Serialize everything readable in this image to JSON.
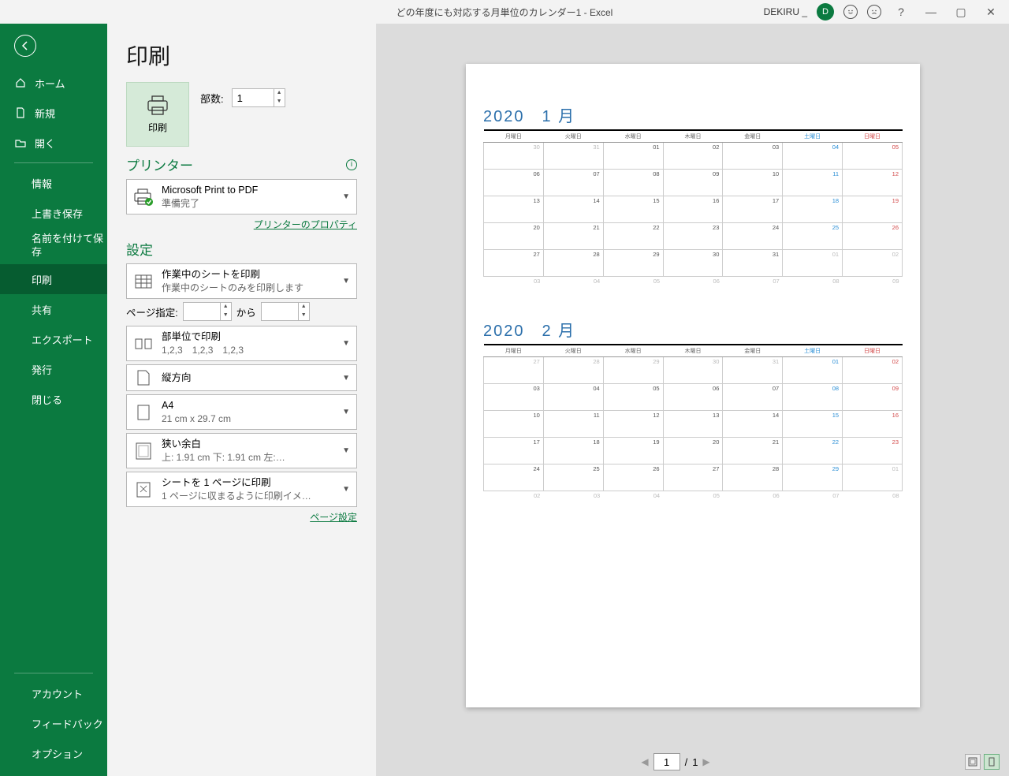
{
  "titlebar": {
    "title": "どの年度にも対応する月単位のカレンダー1  -  Excel",
    "user": "DEKIRU _",
    "avatar": "D"
  },
  "sidebar": {
    "back": "←",
    "home": "ホーム",
    "new": "新規",
    "open": "開く",
    "info": "情報",
    "save": "上書き保存",
    "saveas": "名前を付けて保存",
    "print": "印刷",
    "share": "共有",
    "export": "エクスポート",
    "publish": "発行",
    "close": "閉じる",
    "account": "アカウント",
    "feedback": "フィードバック",
    "options": "オプション"
  },
  "page": {
    "title": "印刷",
    "printbtn": "印刷",
    "copies_label": "部数:",
    "copies_value": "1",
    "printer_head": "プリンター",
    "printer_name": "Microsoft Print to PDF",
    "printer_status": "準備完了",
    "printer_props": "プリンターのプロパティ",
    "settings_head": "設定",
    "s_scope_t": "作業中のシートを印刷",
    "s_scope_s": "作業中のシートのみを印刷します",
    "page_label": "ページ指定:",
    "page_to": "から",
    "s_collate_t": "部単位で印刷",
    "s_collate_s": "1,2,3　1,2,3　1,2,3",
    "s_orient": "縦方向",
    "s_paper_t": "A4",
    "s_paper_s": "21 cm x 29.7 cm",
    "s_margin_t": "狭い余白",
    "s_margin_s": "上: 1.91 cm 下: 1.91 cm 左:…",
    "s_fit_t": "シートを 1 ページに印刷",
    "s_fit_s": "1 ページに収まるように印刷イメ…",
    "page_setup": "ページ設定"
  },
  "preview": {
    "page_current": "1",
    "page_sep": "/",
    "page_total": "1",
    "cal": [
      {
        "year": "2020",
        "month": "1 月",
        "dow": [
          "月曜日",
          "火曜日",
          "水曜日",
          "木曜日",
          "金曜日",
          "土曜日",
          "日曜日"
        ],
        "rows": [
          [
            {
              "v": "30",
              "c": "inactive"
            },
            {
              "v": "31",
              "c": "inactive"
            },
            {
              "v": "01"
            },
            {
              "v": "02"
            },
            {
              "v": "03"
            },
            {
              "v": "04",
              "c": "sat"
            },
            {
              "v": "05",
              "c": "sun"
            }
          ],
          [
            {
              "v": "06"
            },
            {
              "v": "07"
            },
            {
              "v": "08"
            },
            {
              "v": "09"
            },
            {
              "v": "10"
            },
            {
              "v": "11",
              "c": "sat"
            },
            {
              "v": "12",
              "c": "sun"
            }
          ],
          [
            {
              "v": "13"
            },
            {
              "v": "14"
            },
            {
              "v": "15"
            },
            {
              "v": "16"
            },
            {
              "v": "17"
            },
            {
              "v": "18",
              "c": "sat"
            },
            {
              "v": "19",
              "c": "sun"
            }
          ],
          [
            {
              "v": "20"
            },
            {
              "v": "21"
            },
            {
              "v": "22"
            },
            {
              "v": "23"
            },
            {
              "v": "24"
            },
            {
              "v": "25",
              "c": "sat"
            },
            {
              "v": "26",
              "c": "sun"
            }
          ],
          [
            {
              "v": "27"
            },
            {
              "v": "28"
            },
            {
              "v": "29"
            },
            {
              "v": "30"
            },
            {
              "v": "31"
            },
            {
              "v": "01",
              "c": "inactive"
            },
            {
              "v": "02",
              "c": "inactive"
            }
          ],
          [
            {
              "v": "03",
              "c": "inactive"
            },
            {
              "v": "04",
              "c": "inactive"
            },
            {
              "v": "05",
              "c": "inactive"
            },
            {
              "v": "06",
              "c": "inactive"
            },
            {
              "v": "07",
              "c": "inactive"
            },
            {
              "v": "08",
              "c": "inactive"
            },
            {
              "v": "09",
              "c": "inactive"
            }
          ]
        ]
      },
      {
        "year": "2020",
        "month": "2 月",
        "dow": [
          "月曜日",
          "火曜日",
          "水曜日",
          "木曜日",
          "金曜日",
          "土曜日",
          "日曜日"
        ],
        "rows": [
          [
            {
              "v": "27",
              "c": "inactive"
            },
            {
              "v": "28",
              "c": "inactive"
            },
            {
              "v": "29",
              "c": "inactive"
            },
            {
              "v": "30",
              "c": "inactive"
            },
            {
              "v": "31",
              "c": "inactive"
            },
            {
              "v": "01",
              "c": "sat"
            },
            {
              "v": "02",
              "c": "sun"
            }
          ],
          [
            {
              "v": "03"
            },
            {
              "v": "04"
            },
            {
              "v": "05"
            },
            {
              "v": "06"
            },
            {
              "v": "07"
            },
            {
              "v": "08",
              "c": "sat"
            },
            {
              "v": "09",
              "c": "sun"
            }
          ],
          [
            {
              "v": "10"
            },
            {
              "v": "11"
            },
            {
              "v": "12"
            },
            {
              "v": "13"
            },
            {
              "v": "14"
            },
            {
              "v": "15",
              "c": "sat"
            },
            {
              "v": "16",
              "c": "sun"
            }
          ],
          [
            {
              "v": "17"
            },
            {
              "v": "18"
            },
            {
              "v": "19"
            },
            {
              "v": "20"
            },
            {
              "v": "21"
            },
            {
              "v": "22",
              "c": "sat"
            },
            {
              "v": "23",
              "c": "sun"
            }
          ],
          [
            {
              "v": "24"
            },
            {
              "v": "25"
            },
            {
              "v": "26"
            },
            {
              "v": "27"
            },
            {
              "v": "28"
            },
            {
              "v": "29",
              "c": "sat"
            },
            {
              "v": "01",
              "c": "inactive"
            }
          ],
          [
            {
              "v": "02",
              "c": "inactive"
            },
            {
              "v": "03",
              "c": "inactive"
            },
            {
              "v": "04",
              "c": "inactive"
            },
            {
              "v": "05",
              "c": "inactive"
            },
            {
              "v": "06",
              "c": "inactive"
            },
            {
              "v": "07",
              "c": "inactive"
            },
            {
              "v": "08",
              "c": "inactive"
            }
          ]
        ]
      }
    ]
  }
}
